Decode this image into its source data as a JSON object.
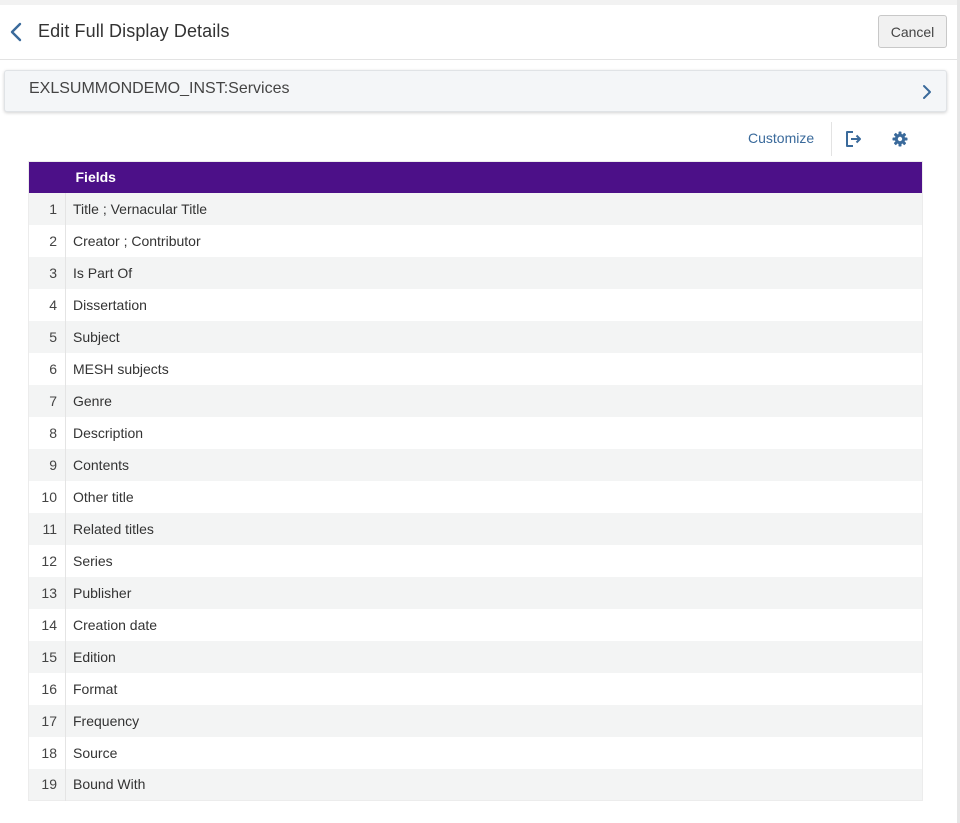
{
  "header": {
    "title": "Edit Full Display Details",
    "cancel_label": "Cancel"
  },
  "services_bar": {
    "label": "EXLSUMMONDEMO_INST:Services"
  },
  "toolbar": {
    "customize_label": "Customize"
  },
  "table": {
    "header": "Fields",
    "rows": [
      {
        "num": "1",
        "field": "Title ; Vernacular Title"
      },
      {
        "num": "2",
        "field": "Creator ; Contributor"
      },
      {
        "num": "3",
        "field": "Is Part Of"
      },
      {
        "num": "4",
        "field": "Dissertation"
      },
      {
        "num": "5",
        "field": "Subject"
      },
      {
        "num": "6",
        "field": "MESH subjects"
      },
      {
        "num": "7",
        "field": "Genre"
      },
      {
        "num": "8",
        "field": "Description"
      },
      {
        "num": "9",
        "field": "Contents"
      },
      {
        "num": "10",
        "field": "Other title"
      },
      {
        "num": "11",
        "field": "Related titles"
      },
      {
        "num": "12",
        "field": "Series"
      },
      {
        "num": "13",
        "field": "Publisher"
      },
      {
        "num": "14",
        "field": "Creation date"
      },
      {
        "num": "15",
        "field": "Edition"
      },
      {
        "num": "16",
        "field": "Format"
      },
      {
        "num": "17",
        "field": "Frequency"
      },
      {
        "num": "18",
        "field": "Source"
      },
      {
        "num": "19",
        "field": "Bound With"
      }
    ]
  },
  "icons": {
    "back": "chevron-left-icon",
    "expand": "chevron-right-icon",
    "export": "export-icon",
    "settings": "gear-icon"
  },
  "colors": {
    "accent": "#3a6a9b",
    "table_header": "#4c1088",
    "row_stripe": "#f3f4f4"
  }
}
